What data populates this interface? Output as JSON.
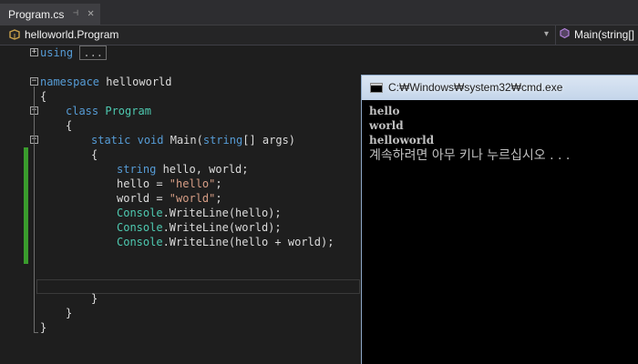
{
  "tab": {
    "title": "Program.cs",
    "pin": "⊣",
    "close": "✕"
  },
  "navbar": {
    "class_path": "helloworld.Program",
    "method": "Main(string[]",
    "dropdown": "▾"
  },
  "code": {
    "using_kw": "using",
    "using_collapsed": "...",
    "namespace_kw": "namespace",
    "namespace_name": " helloworld",
    "brace_open": "{",
    "brace_close": "}",
    "class_kw": "class",
    "class_name": "Program",
    "static_kw": "static",
    "void_kw": "void",
    "main_sig_a": " Main(",
    "string_kw": "string",
    "main_sig_b": "[] args)",
    "decl_rest": " hello, world;",
    "hello_assign": "hello = ",
    "hello_lit": "\"hello\"",
    "world_assign": "world = ",
    "world_lit": "\"world\"",
    "semicolon": ";",
    "console_type": "Console",
    "write1_rest": ".WriteLine(hello);",
    "write2_rest": ".WriteLine(world);",
    "write3_rest": ".WriteLine(hello + world);"
  },
  "console_window": {
    "title": "C:₩Windows₩system32₩cmd.exe",
    "lines": [
      "hello",
      "world",
      "helloworld"
    ],
    "prompt": "계속하려면 아무 키나 누르십시오 . . ."
  },
  "colors": {
    "keyword": "#569cd6",
    "type": "#4ec9b0",
    "string": "#d69d85",
    "changed": "#3a9c2d"
  }
}
